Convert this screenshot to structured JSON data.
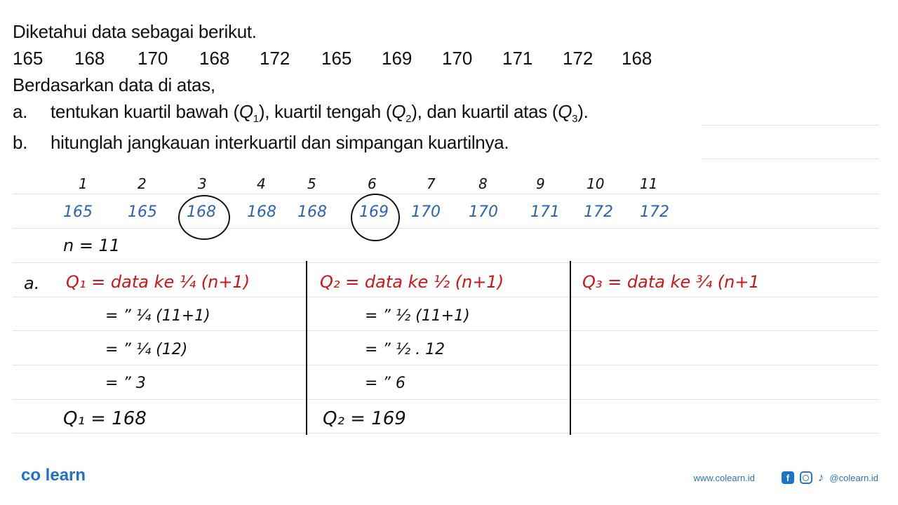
{
  "problem": {
    "intro": "Diketahui data sebagai berikut.",
    "data_values": [
      "165",
      "168",
      "170",
      "168",
      "172",
      "165",
      "169",
      "170",
      "171",
      "172",
      "168"
    ],
    "based_on": "Berdasarkan data di atas,",
    "part_a": {
      "label": "a.",
      "text_1": "tentukan kuartil bawah (",
      "q1": "Q",
      "q1_sub": "1",
      "text_2": "), kuartil tengah (",
      "q2": "Q",
      "q2_sub": "2",
      "text_3": "), dan kuartil atas (",
      "q3": "Q",
      "q3_sub": "3",
      "text_4": ")."
    },
    "part_b": {
      "label": "b.",
      "text": "hitunglah jangkauan interkuartil dan simpangan kuartilnya."
    }
  },
  "handwriting": {
    "indices": [
      "1",
      "2",
      "3",
      "4",
      "5",
      "6",
      "7",
      "8",
      "9",
      "10",
      "11"
    ],
    "sorted_values": [
      "165",
      "165",
      "168",
      "168",
      "168",
      "169",
      "170",
      "170",
      "171",
      "172",
      "172"
    ],
    "circled_positions": [
      3,
      6
    ],
    "n_line": "n = 11",
    "part_label": "a.",
    "q1_column": {
      "formula": "Q₁ = data ke ¼ (n+1)",
      "step1": "=  ”   ¼ (11+1)",
      "step2": "=  ”   ¼ (12)",
      "step3": "=  ”   3",
      "result": "Q₁  = 168"
    },
    "q2_column": {
      "formula": "Q₂ = data ke ½ (n+1)",
      "step1": "=  ”   ½ (11+1)",
      "step2": "=  ”   ½ . 12",
      "step3": "=  ”   6",
      "result": "Q₂  = 169"
    },
    "q3_column": {
      "formula": "Q₃ = data ke ¾ (n+1"
    },
    "colors": {
      "values": "#2a63b8",
      "formula": "#d11414",
      "work": "#111111"
    }
  },
  "footer": {
    "logo": "co learn",
    "website": "www.colearn.id",
    "social_icons": [
      "facebook-icon",
      "instagram-icon",
      "tiktok-icon"
    ],
    "handle": "@colearn.id",
    "brand_color": "#1e73c8"
  }
}
